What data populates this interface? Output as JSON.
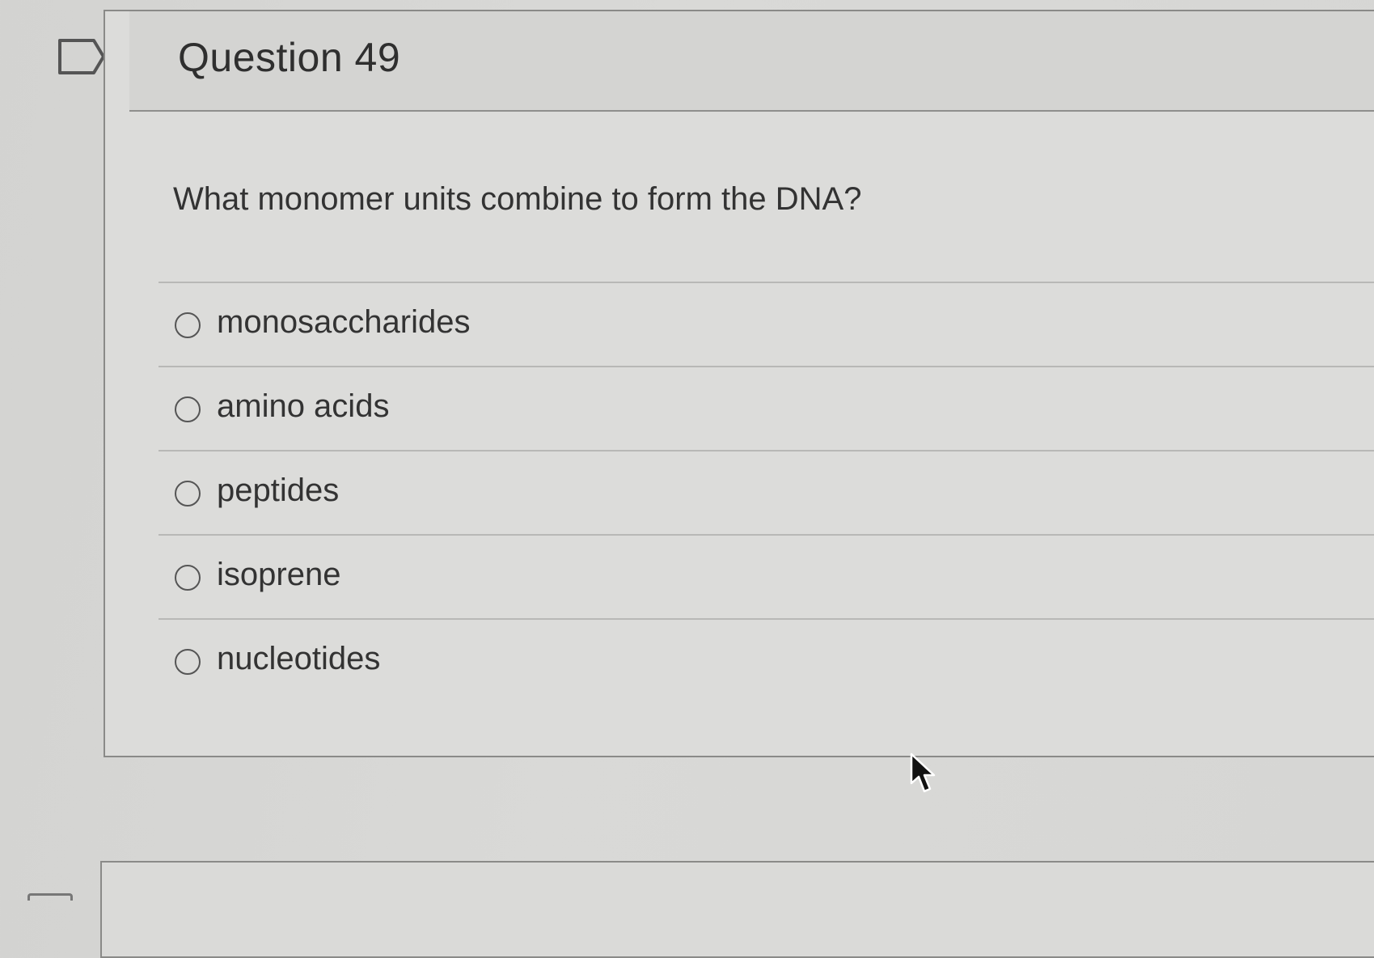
{
  "question": {
    "title": "Question 49",
    "prompt": "What monomer units combine to form the DNA?",
    "answers": [
      {
        "label": "monosaccharides",
        "selected": false
      },
      {
        "label": "amino acids",
        "selected": false
      },
      {
        "label": "peptides",
        "selected": false
      },
      {
        "label": "isoprene",
        "selected": false
      },
      {
        "label": "nucleotides",
        "selected": false
      }
    ]
  },
  "icons": {
    "flag": "flag-icon",
    "cursor": "mouse-pointer-icon",
    "radio": "radio-button-icon"
  },
  "colors": {
    "background": "#d8d8d6",
    "border": "#8a8a88",
    "text": "#333333"
  }
}
